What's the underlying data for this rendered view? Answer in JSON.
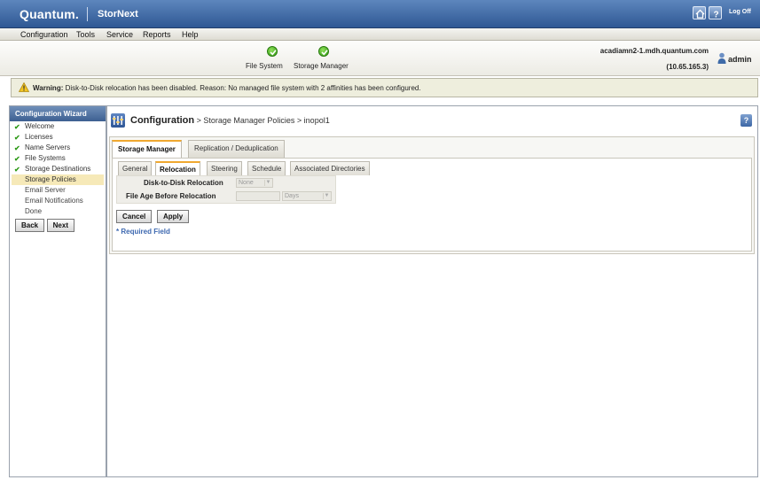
{
  "header": {
    "brand": "Quantum.",
    "product": "StorNext",
    "logoff_label": "Log Off"
  },
  "menu": [
    "Configuration",
    "Tools",
    "Service",
    "Reports",
    "Help"
  ],
  "status": {
    "file_system_label": "File System",
    "storage_manager_label": "Storage Manager",
    "host": "acadiamn2-1.mdh.quantum.com",
    "ip": "(10.65.165.3)",
    "user": "admin"
  },
  "warning": {
    "label": "Warning:",
    "message": "Disk-to-Disk relocation has been disabled. Reason: No managed file system with 2 affinities has been configured."
  },
  "wizard": {
    "title": "Configuration Wizard",
    "items": [
      {
        "label": "Welcome",
        "state": "done"
      },
      {
        "label": "Licenses",
        "state": "done"
      },
      {
        "label": "Name Servers",
        "state": "done"
      },
      {
        "label": "File Systems",
        "state": "done"
      },
      {
        "label": "Storage Destinations",
        "state": "done"
      },
      {
        "label": "Storage Policies",
        "state": "current"
      },
      {
        "label": "Email Server",
        "state": "todo"
      },
      {
        "label": "Email Notifications",
        "state": "todo"
      },
      {
        "label": "Done",
        "state": "todo"
      }
    ],
    "back_label": "Back",
    "next_label": "Next"
  },
  "page": {
    "title": "Configuration",
    "crumb": " > Storage Manager Policies > inopol1",
    "help_label": "?"
  },
  "tabs": {
    "top": [
      "Storage Manager",
      "Replication / Deduplication"
    ],
    "sub": [
      "General",
      "Relocation",
      "Steering",
      "Schedule",
      "Associated Directories"
    ]
  },
  "form": {
    "d2d_label": "Disk-to-Disk Relocation",
    "d2d_value": "None",
    "age_label": "File Age Before Relocation",
    "age_value": "",
    "age_unit": "Days"
  },
  "actions": {
    "cancel_label": "Cancel",
    "apply_label": "Apply",
    "required_note": "* Required Field"
  },
  "colors": {
    "title_bar": "#3f68a3",
    "wizard_header": "#4f719f",
    "current_step": "#f6e9b8",
    "active_tab_accent": "#f0a830",
    "check_green": "#2e9a18",
    "required_blue": "#3d68b0"
  }
}
